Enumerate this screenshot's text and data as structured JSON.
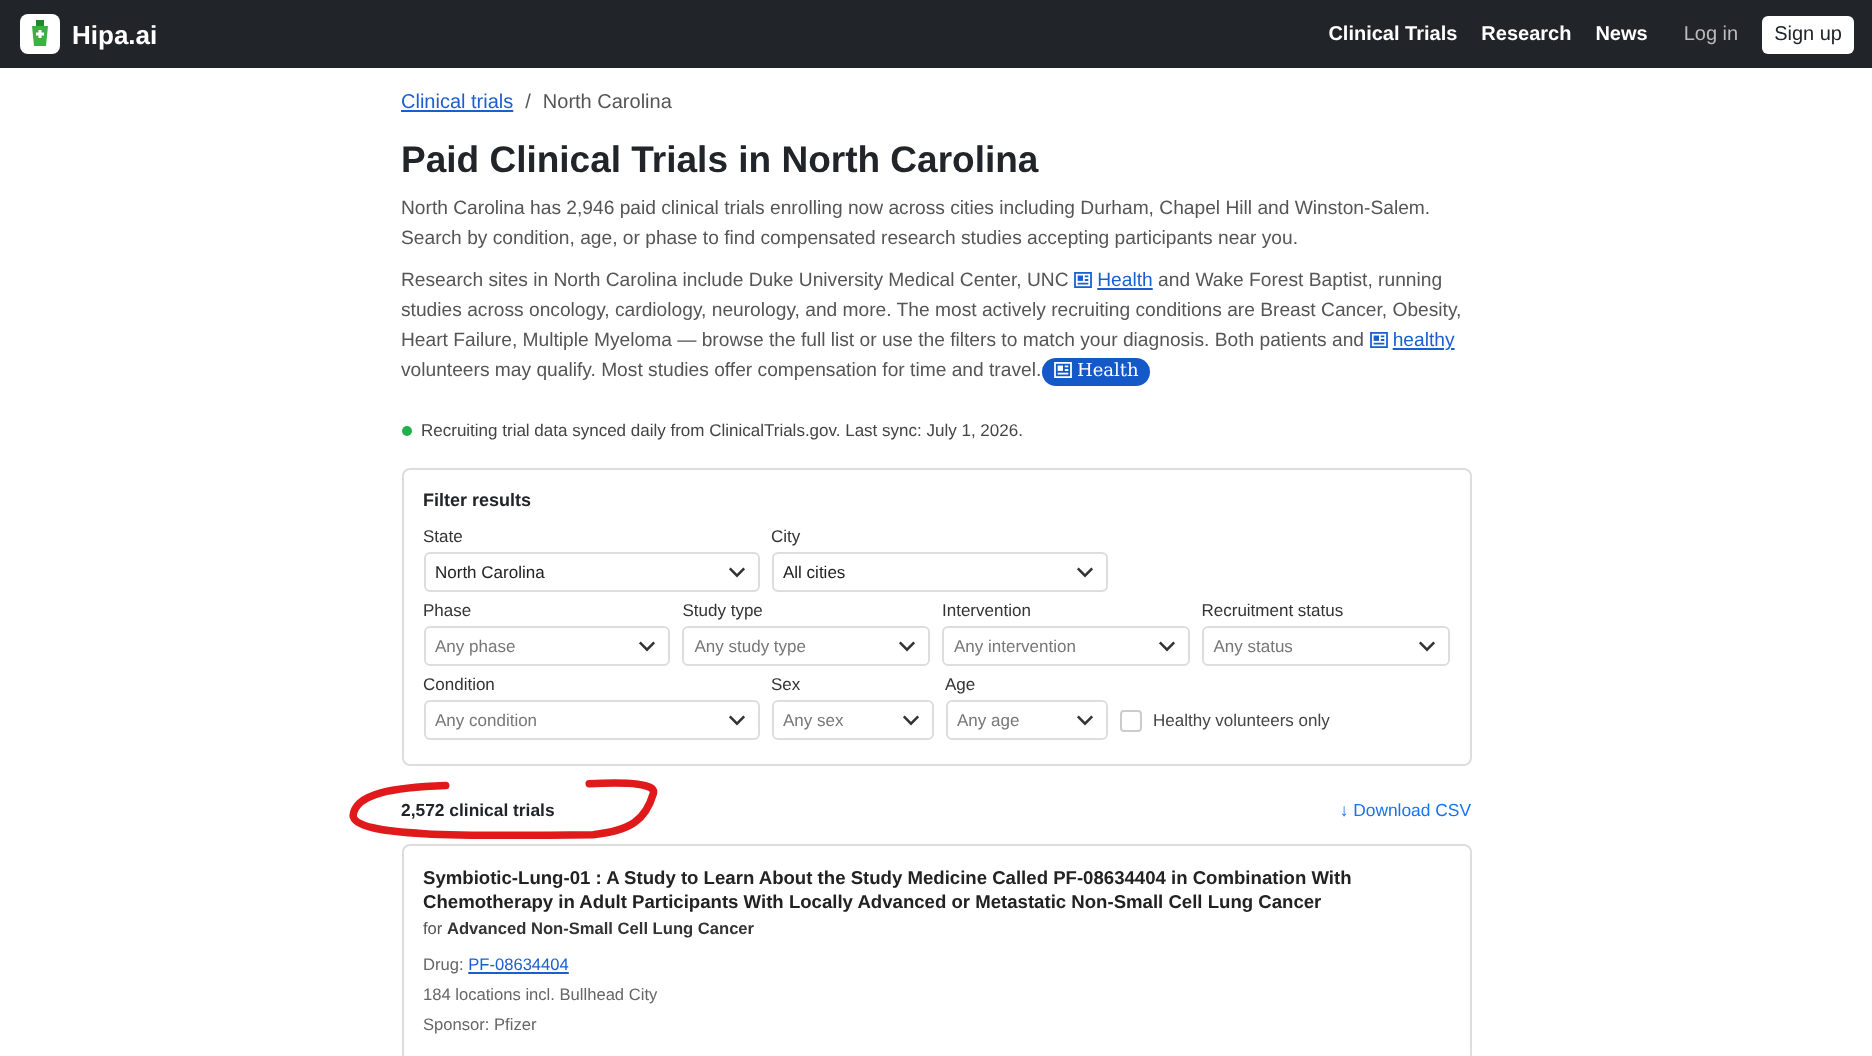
{
  "nav": {
    "brand": "Hipa.ai",
    "links": [
      "Clinical Trials",
      "Research",
      "News"
    ],
    "login": "Log in",
    "signup": "Sign up"
  },
  "breadcrumb": {
    "link": "Clinical trials",
    "separator": "/",
    "current": "North Carolina"
  },
  "title": "Paid Clinical Trials in North Carolina",
  "intro": "North Carolina has 2,946 paid clinical trials enrolling now across cities including Durham, Chapel Hill and Winston-Salem. Search by condition, age, or phase to find compensated research studies accepting participants near you.",
  "details": [
    {
      "kind": "text",
      "text": "Research sites in North Carolina include Duke University Medical Center, UNC "
    },
    {
      "kind": "link",
      "text": "Health"
    },
    {
      "kind": "text",
      "text": " and Wake Forest Baptist, running studies across oncology, cardiology, neurology, and more. The most actively recruiting conditions are Breast Cancer, Obesity, Heart Failure, Multiple Myeloma — browse the full list or use the filters to match your diagnosis. Both patients and "
    },
    {
      "kind": "link",
      "text": "healthy"
    },
    {
      "kind": "text",
      "text": " volunteers may qualify. Most studies offer compensation for time and travel."
    },
    {
      "kind": "badge",
      "text": "Health"
    }
  ],
  "sync_note": "Recruiting trial data synced daily from ClinicalTrials.gov. Last sync: July 1, 2026.",
  "filters": {
    "title": "Filter results",
    "rows": [
      [
        {
          "label": "State",
          "value": "North Carolina"
        },
        {
          "label": "City",
          "value": "All cities"
        }
      ],
      [
        {
          "label": "Phase",
          "placeholder": "Any phase"
        },
        {
          "label": "Study type",
          "placeholder": "Any study type"
        },
        {
          "label": "Intervention",
          "placeholder": "Any intervention"
        },
        {
          "label": "Recruitment status",
          "placeholder": "Any status"
        }
      ],
      [
        {
          "label": "Condition",
          "placeholder": "Any condition"
        },
        {
          "label": "Sex",
          "placeholder": "Any sex"
        },
        {
          "label": "Age",
          "placeholder": "Any age"
        }
      ]
    ],
    "checkbox": {
      "label": "Healthy volunteers only",
      "checked": false
    }
  },
  "results": {
    "count": "2,572 clinical trials",
    "download": "↓ Download CSV",
    "trials": [
      {
        "title": "Symbiotic-Lung-01 : A Study to Learn About the Study Medicine Called PF-08634404 in Combination With Chemotherapy in Adult Participants With Locally Advanced or Metastatic Non-Small Cell Lung Cancer",
        "for_prefix": "for",
        "condition": "Advanced Non-Small Cell Lung Cancer",
        "drug_label": "Drug:",
        "drug": "PF-08634404",
        "locations": "184 locations incl. Bullhead City",
        "sponsor": "Sponsor: Pfizer"
      }
    ]
  }
}
